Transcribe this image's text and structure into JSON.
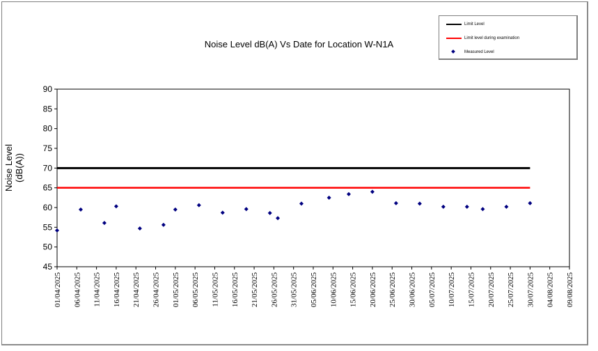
{
  "chart_data": {
    "type": "line",
    "title": "Noise Level dB(A) Vs Date for Location W-N1A",
    "ylabel_line1": "Noise Level",
    "ylabel_line2": "(dB(A))",
    "xlabel": "",
    "ylim": [
      45,
      90
    ],
    "y_ticks": [
      45,
      50,
      55,
      60,
      65,
      70,
      75,
      80,
      85,
      90
    ],
    "x_range": [
      "2025-04-01",
      "2025-08-09"
    ],
    "x_tick_labels": [
      "01/04/2025",
      "06/04/2025",
      "11/04/2025",
      "16/04/2025",
      "21/04/2025",
      "26/04/2025",
      "01/05/2025",
      "06/05/2025",
      "11/05/2025",
      "16/05/2025",
      "21/05/2025",
      "26/05/2025",
      "31/05/2025",
      "05/06/2025",
      "10/06/2025",
      "15/06/2025",
      "20/06/2025",
      "25/06/2025",
      "30/06/2025",
      "05/07/2025",
      "10/07/2025",
      "15/07/2025",
      "20/07/2025",
      "25/07/2025",
      "30/07/2025",
      "04/08/2025",
      "09/08/2025"
    ],
    "grid": false,
    "legend_position": "top-right",
    "series": [
      {
        "name": "Limit Level",
        "kind": "line",
        "color": "#000000",
        "points": [
          [
            "2025-04-01",
            70
          ],
          [
            "2025-07-30",
            70
          ]
        ]
      },
      {
        "name": "Limit level during examination",
        "kind": "line",
        "color": "#ff0000",
        "points": [
          [
            "2025-04-01",
            65
          ],
          [
            "2025-07-30",
            65
          ]
        ]
      },
      {
        "name": "Measured Level",
        "kind": "scatter",
        "color": "#000080",
        "points": [
          [
            "2025-04-01",
            54.2
          ],
          [
            "2025-04-07",
            59.5
          ],
          [
            "2025-04-13",
            56.1
          ],
          [
            "2025-04-16",
            60.3
          ],
          [
            "2025-04-22",
            54.7
          ],
          [
            "2025-04-28",
            55.6
          ],
          [
            "2025-05-01",
            59.5
          ],
          [
            "2025-05-07",
            60.6
          ],
          [
            "2025-05-13",
            58.7
          ],
          [
            "2025-05-19",
            59.6
          ],
          [
            "2025-05-25",
            58.6
          ],
          [
            "2025-05-27",
            57.3
          ],
          [
            "2025-06-02",
            61.0
          ],
          [
            "2025-06-09",
            62.5
          ],
          [
            "2025-06-14",
            63.4
          ],
          [
            "2025-06-20",
            64.0
          ],
          [
            "2025-06-26",
            61.1
          ],
          [
            "2025-07-02",
            61.0
          ],
          [
            "2025-07-08",
            60.2
          ],
          [
            "2025-07-14",
            60.2
          ],
          [
            "2025-07-18",
            59.6
          ],
          [
            "2025-07-24",
            60.2
          ],
          [
            "2025-07-30",
            61.1
          ]
        ]
      }
    ]
  }
}
